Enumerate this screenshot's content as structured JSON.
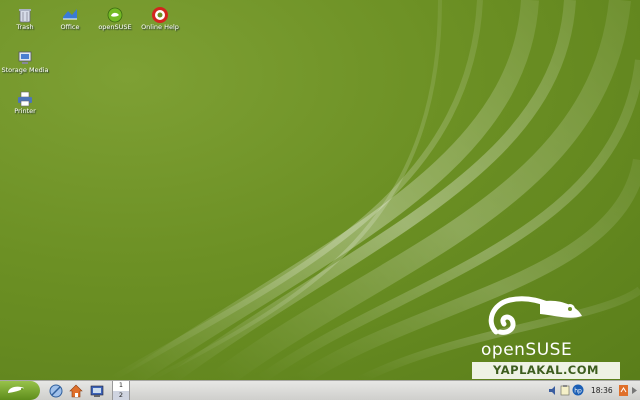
{
  "desktop": {
    "icons": [
      {
        "label": "Trash",
        "icon": "trash-icon"
      },
      {
        "label": "Office",
        "icon": "office-icon"
      },
      {
        "label": "openSUSE",
        "icon": "opensuse-icon"
      },
      {
        "label": "Online Help",
        "icon": "help-lifebuoy-icon"
      },
      {
        "label": "Storage Media",
        "icon": "storage-media-icon"
      },
      {
        "label": "Printer",
        "icon": "printer-icon"
      }
    ],
    "brand": "openSUSE",
    "watermark": "YAPLAKAL.COM"
  },
  "taskbar": {
    "pager": [
      "1",
      "2"
    ],
    "clock": "18:36",
    "quick_launch": [
      "konqueror-icon",
      "home-icon",
      "system-icon"
    ],
    "tray": [
      "speaker-icon",
      "clipboard-icon",
      "hp-icon",
      "network-icon"
    ]
  },
  "colors": {
    "desktop_green": "#6c9024",
    "accent": "#5e8d1c"
  }
}
